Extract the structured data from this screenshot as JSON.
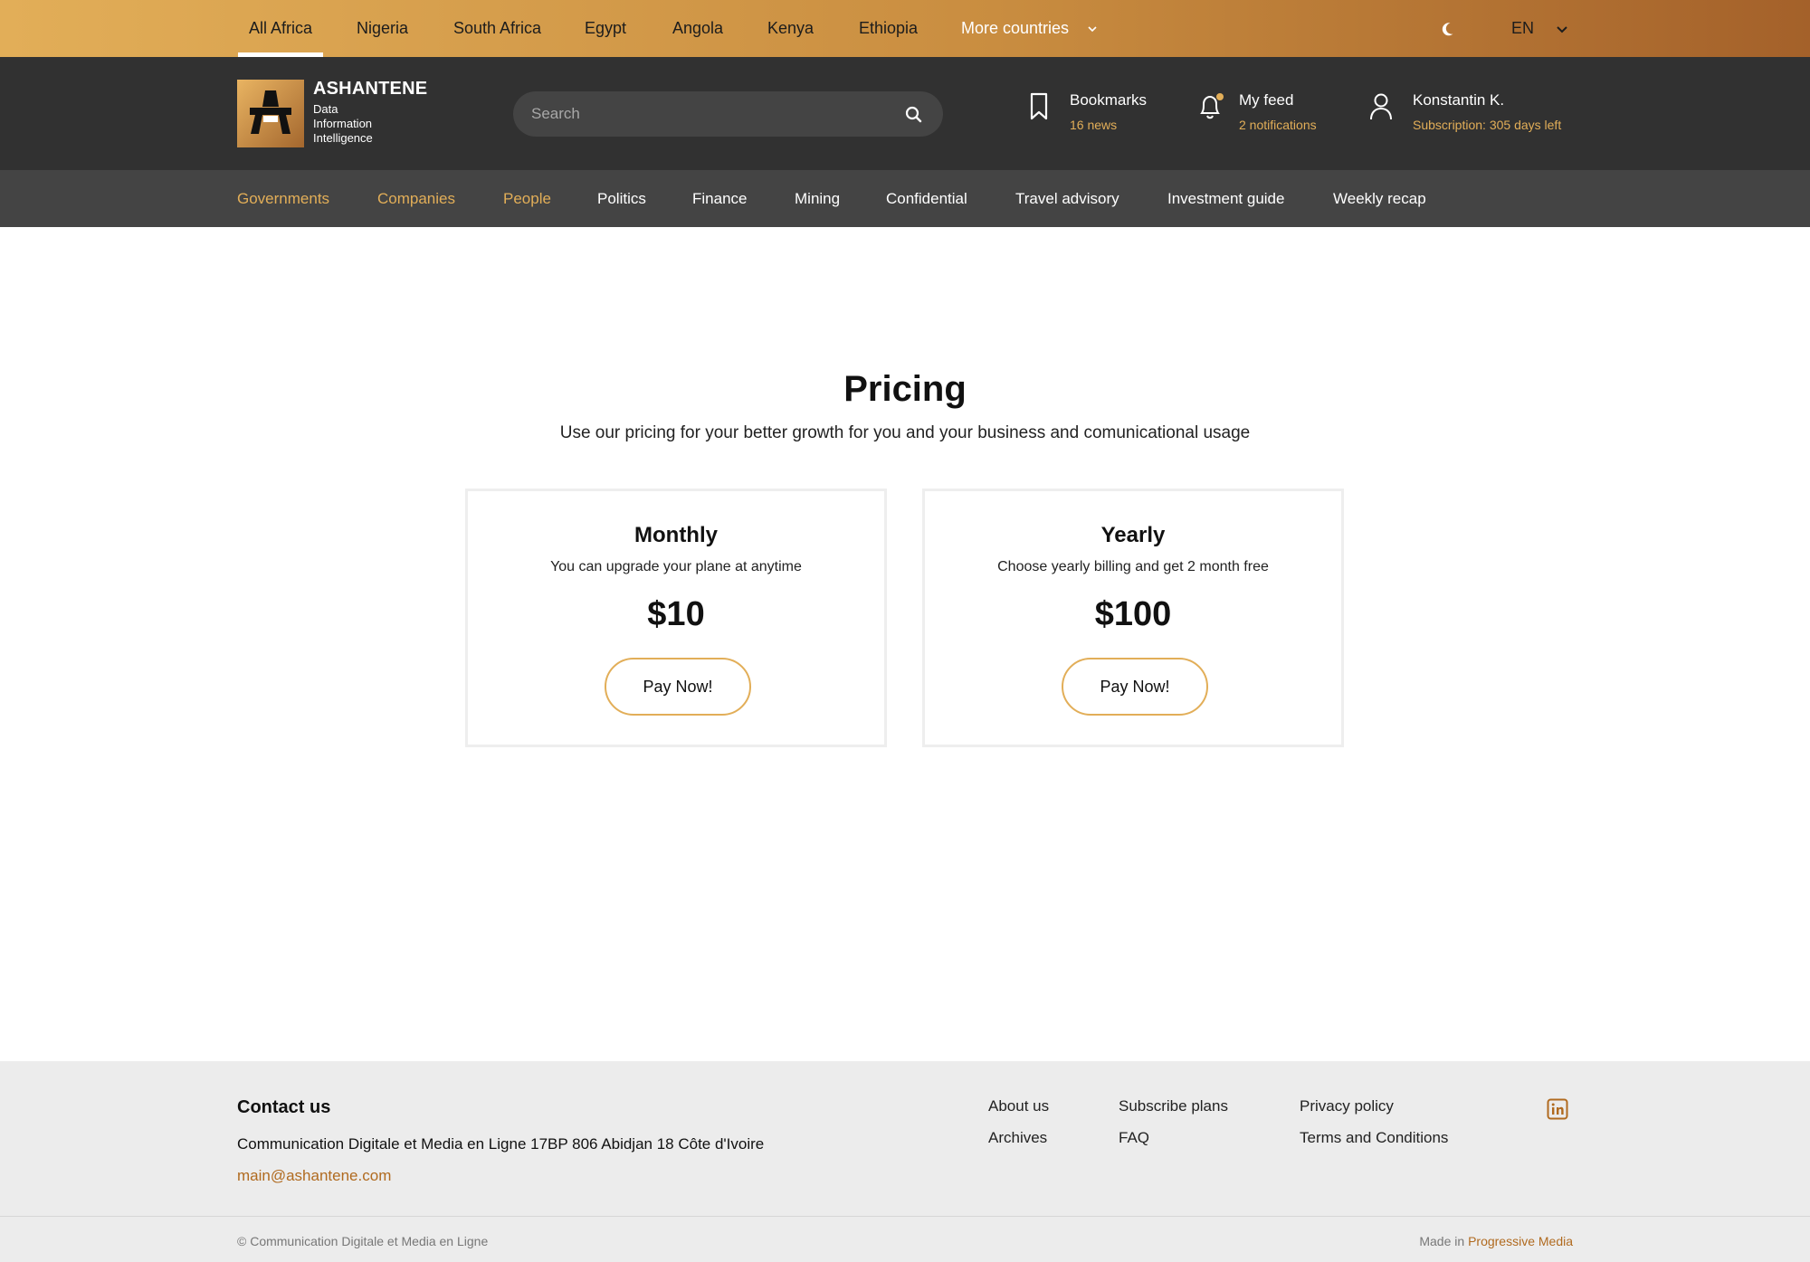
{
  "countries": {
    "items": [
      "All Africa",
      "Nigeria",
      "South Africa",
      "Egypt",
      "Angola",
      "Kenya",
      "Ethiopia"
    ],
    "active": "All Africa",
    "more_label": "More countries"
  },
  "language": {
    "selected": "EN"
  },
  "brand": {
    "name": "ASHANTENE",
    "tagline_1": "Data",
    "tagline_2": "Information",
    "tagline_3": "Intelligence"
  },
  "search": {
    "placeholder": "Search",
    "value": ""
  },
  "header": {
    "bookmarks": {
      "title": "Bookmarks",
      "sub": "16 news"
    },
    "feed": {
      "title": "My feed",
      "sub": "2 notifications"
    },
    "user": {
      "title": "Konstantin K.",
      "sub": "Subscription: 305 days left"
    }
  },
  "nav": {
    "items": [
      "Governments",
      "Companies",
      "People",
      "Politics",
      "Finance",
      "Mining",
      "Confidential",
      "Travel advisory",
      "Investment guide",
      "Weekly recap"
    ]
  },
  "pricing": {
    "title": "Pricing",
    "subtitle": "Use our pricing for your better growth for you and your business and comunicational usage",
    "plans": [
      {
        "title": "Monthly",
        "desc": "You can upgrade your plane at anytime",
        "price": "$10",
        "button": "Pay Now!"
      },
      {
        "title": "Yearly",
        "desc": "Choose yearly billing and get 2 month free",
        "price": "$100",
        "button": "Pay Now!"
      }
    ]
  },
  "footer": {
    "contact_title": "Contact us",
    "address": "Communication Digitale et Media en Ligne 17BP 806 Abidjan 18 Côte d'Ivoire",
    "email": "main@ashantene.com",
    "links": {
      "about": "About us",
      "archives": "Archives",
      "subscribe": "Subscribe plans",
      "faq": "FAQ",
      "privacy": "Privacy policy",
      "terms": "Terms and Conditions"
    },
    "copyright": "© Communication Digitale et Media en Ligne",
    "made_in_prefix": "Made in",
    "made_in_brand": "Progressive Media"
  },
  "colors": {
    "accent_gold": "#e2ae58",
    "header_bg": "#313131",
    "nav_bg": "#444444",
    "footer_bg": "#ececec",
    "link_brown": "#b06a1f"
  },
  "icons": {
    "theme": "moon-icon",
    "lang_toggle": "chevron-down-icon",
    "search": "search-icon",
    "bookmarks": "bookmark-icon",
    "feed": "bell-icon",
    "user": "user-icon",
    "social": "linkedin-icon"
  }
}
